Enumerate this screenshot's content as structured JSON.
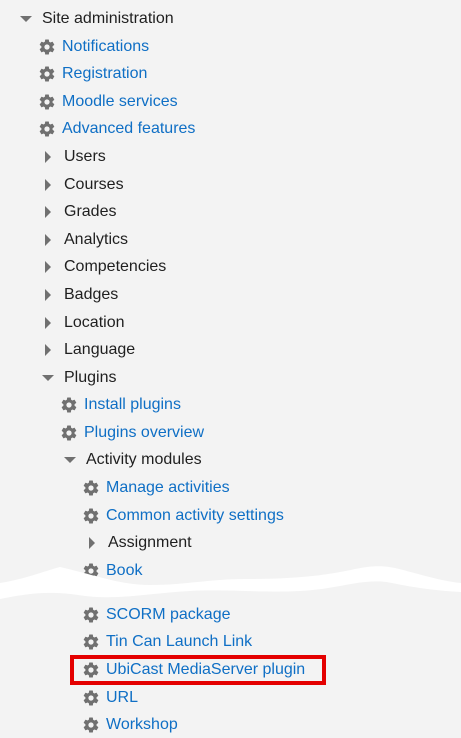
{
  "tree": {
    "root_label": "Site administration",
    "notifications": "Notifications",
    "registration": "Registration",
    "moodle_services": "Moodle services",
    "advanced_features": "Advanced features",
    "users": "Users",
    "courses": "Courses",
    "grades": "Grades",
    "analytics": "Analytics",
    "competencies": "Competencies",
    "badges": "Badges",
    "location": "Location",
    "language": "Language",
    "plugins": "Plugins",
    "install_plugins": "Install plugins",
    "plugins_overview": "Plugins overview",
    "activity_modules": "Activity modules",
    "manage_activities": "Manage activities",
    "common_activity_settings": "Common activity settings",
    "assignment": "Assignment",
    "book": "Book",
    "scorm_package": "SCORM package",
    "tin_can_launch_link": "Tin Can Launch Link",
    "ubicast_mediaserver_plugin": "UbiCast MediaServer plugin",
    "url": "URL",
    "workshop": "Workshop"
  },
  "colors": {
    "link": "#0f6fc5",
    "text": "#1f1f1f",
    "icon": "#707070",
    "highlight_border": "#e40000",
    "background": "#f3f3f3"
  },
  "icons": {
    "settings_item": "gear-icon",
    "expanded": "caret-down-icon",
    "collapsed": "caret-right-icon"
  }
}
